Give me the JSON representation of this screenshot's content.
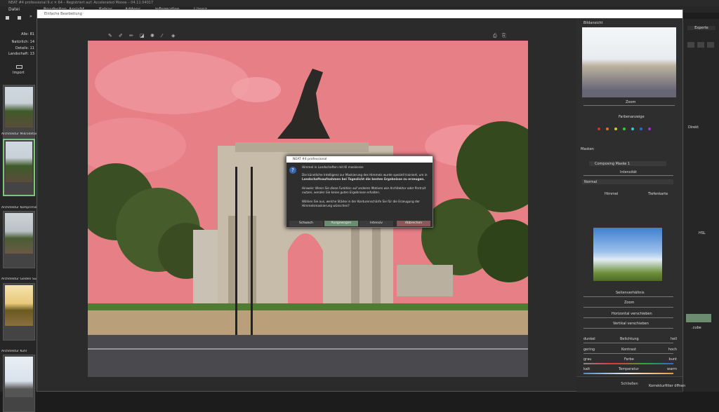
{
  "app": {
    "title": "NEAT #4 professional 9.x ✕ 64 – Registriert auf: Accelerated Moose – 04.11.04017"
  },
  "menu": [
    "Datei",
    "Bearbeiten",
    "Ansicht",
    "Extras",
    "Addons",
    "Information",
    "Lizenz"
  ],
  "left": {
    "counts": [
      {
        "label": "Alle: 81"
      },
      {
        "label": "Natürlich: 14"
      },
      {
        "label": "Details: 11"
      },
      {
        "label": "Landschaft: 13"
      }
    ],
    "import_label": "Import",
    "thumbs": [
      "Architektur Mikrodetail",
      "Architektur Komprimiert",
      "Architektur Golden Sun",
      "Architektur Kühl"
    ]
  },
  "editor": {
    "title": "Einfache Bearbeitung"
  },
  "dialog": {
    "title": "NEAT #4 professional",
    "heading": "Himmel in Landschaften mit KI maskieren",
    "p1a": "Die künstliche Intelligenz zur Maskierung des Himmels wurde speziell trainiert, um in",
    "p1b": "Landschaftsaufnahmen bei Tageslicht die besten Ergebnisse zu erzeugen.",
    "p2a": "Hinweis: Wenn Sie diese Funktion auf anderen Motiven wie Architektur oder Portrait",
    "p2b": "nutzen, werden Sie keine guten Ergebnisse erhalten.",
    "p3a": "Wählen Sie aus, welche Stärke in der Konturenschärfe Sie für die Erzeugung der",
    "p3b": "Himmelsmaskierung wünschen?",
    "buttons": {
      "weak": "Schwach",
      "balanced": "Ausgewogen",
      "strong": "Intensiv",
      "cancel": "Abbrechen"
    }
  },
  "right": {
    "preview_title": "Bildansicht",
    "zoom_label": "Zoom",
    "color_label": "Farbenanzeige",
    "masks_title": "Masken",
    "mask_item": "Composing Maske 1",
    "intensity": "Intensität",
    "blend": "Normal",
    "sky_btn": "Himmel",
    "depth_btn": "Tiefenkarte",
    "sliders": [
      "Seitenverhältnis",
      "Zoom",
      "Horizontal verschieben",
      "Vertikal verschieben"
    ],
    "brightness": {
      "label": "Belichtung",
      "min": "dunkel",
      "max": "hell"
    },
    "contrast": {
      "label": "Kontrast",
      "min": "gering",
      "max": "hoch"
    },
    "color": {
      "label": "Farbe",
      "min": "grau",
      "max": "bunt"
    },
    "temp": {
      "label": "Temperatur",
      "min": "kalt",
      "max": "warm"
    },
    "close": "Schließen"
  },
  "farright": {
    "expert": "Experte",
    "label1": "Direkt",
    "label2": "HSL",
    "label3": ".cube",
    "bottom": "Korrekturfilter öffnen"
  },
  "colors": {
    "sky": "#e77f86",
    "accent_green": "#6c8c70",
    "accent_red": "#8e5757"
  }
}
